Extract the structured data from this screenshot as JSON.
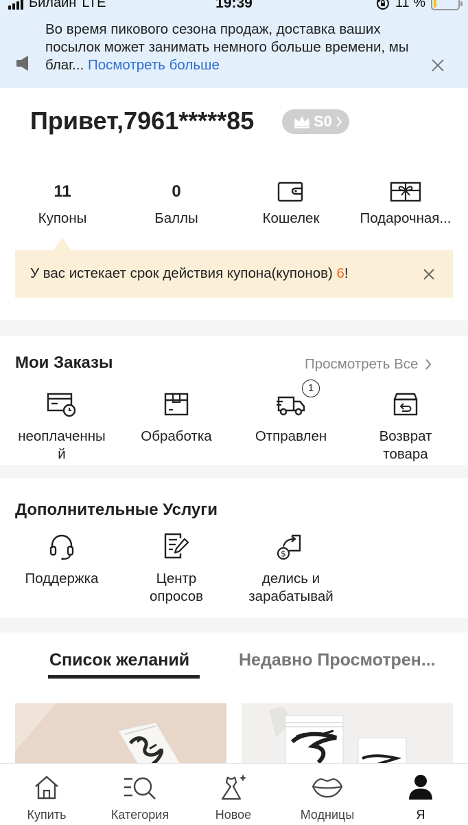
{
  "status_bar": {
    "carrier": "Билайн",
    "network": "LTE",
    "time": "19:39",
    "battery": "11 %",
    "battery_level": 0.11
  },
  "notice": {
    "text": "Во время пикового сезона продаж, доставка ваших посылок может занимать немного больше времени, мы благ...",
    "link": "Посмотреть больше"
  },
  "greeting": {
    "text": "Привет,7961*****85",
    "level": "S0"
  },
  "stats": {
    "coupons": {
      "value": "11",
      "label": "Купоны"
    },
    "points": {
      "value": "0",
      "label": "Баллы"
    },
    "wallet": {
      "label": "Кошелек",
      "icon": "wallet-icon"
    },
    "gift_card": {
      "label": "Подарочная...",
      "icon": "gift-card-icon"
    }
  },
  "coupon_warning": {
    "text": "У вас истекает срок действия купона(купонов) ",
    "count": "6",
    "suffix": "!"
  },
  "orders": {
    "title": "Мои Заказы",
    "view_all": "Просмотреть Все",
    "items": [
      {
        "label": "неоплаченны\nй",
        "icon": "card-clock-icon"
      },
      {
        "label": "Обработка",
        "icon": "box-icon"
      },
      {
        "label": "Отправлен",
        "icon": "truck-icon",
        "badge": "1"
      },
      {
        "label": "Возврат\nтовара",
        "icon": "return-box-icon"
      }
    ]
  },
  "services": {
    "title": "Дополнительные Услуги",
    "items": [
      {
        "label": "Поддержка",
        "icon": "headset-icon"
      },
      {
        "label": "Центр\nопросов",
        "icon": "survey-icon"
      },
      {
        "label": "делись и\nзарабатывай",
        "icon": "share-earn-icon"
      }
    ]
  },
  "tabs": {
    "active": "Список желаний",
    "inactive": "Недавно Просмотрен..."
  },
  "bottom_nav": [
    {
      "label": "Купить",
      "icon": "home-icon"
    },
    {
      "label": "Категория",
      "icon": "category-search-icon"
    },
    {
      "label": "Новое",
      "icon": "dress-sparkle-icon"
    },
    {
      "label": "Модницы",
      "icon": "lips-icon"
    },
    {
      "label": "Я",
      "icon": "person-icon"
    }
  ],
  "colors": {
    "banner_bg": "#e3effa",
    "link": "#2f6fd1",
    "warning_bg": "#fbefd8",
    "accent_orange": "#f06a1d",
    "badge_grey": "#cfcfcf"
  }
}
